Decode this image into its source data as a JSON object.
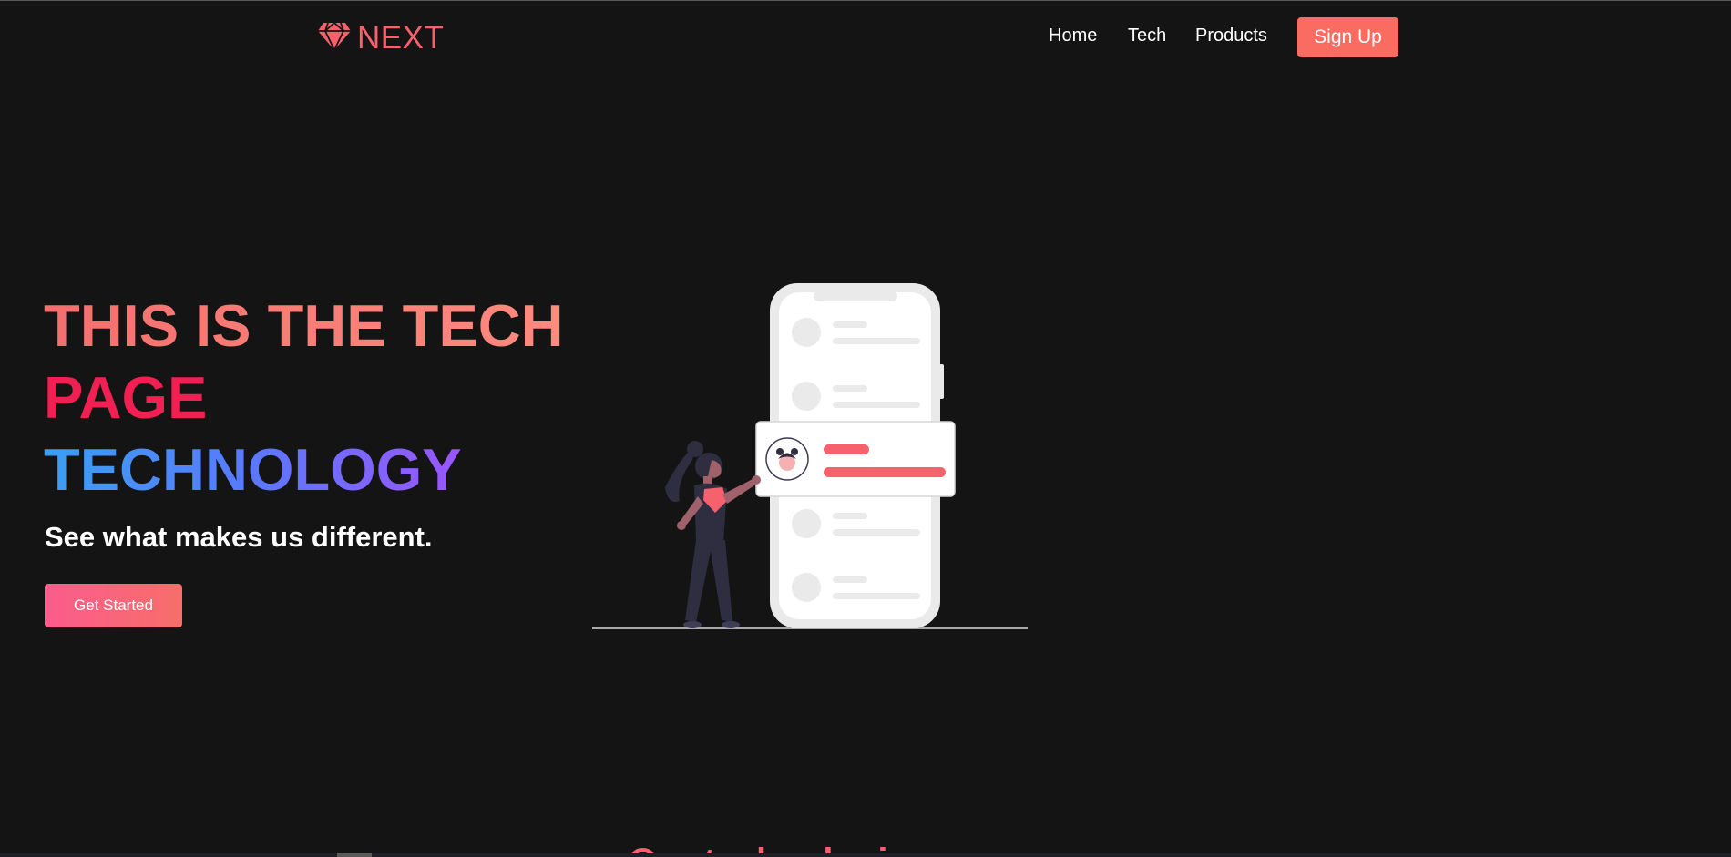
{
  "navbar": {
    "logo_text": "NEXT",
    "links": [
      {
        "label": "Home"
      },
      {
        "label": "Tech"
      },
      {
        "label": "Products"
      }
    ],
    "signup_label": "Sign Up"
  },
  "hero": {
    "line1": "THIS IS THE TECH",
    "line2": "PAGE",
    "line3": "TECHNOLOGY",
    "subtitle": "See what makes us different.",
    "cta_label": "Get Started"
  },
  "next_section": {
    "heading_partial": "Our technologies"
  },
  "colors": {
    "background": "#141414",
    "brand": "#f7616d",
    "signup_button": "#fa6c62",
    "page_red": "#f21f53"
  },
  "icons": {
    "logo": "diamond-icon"
  }
}
